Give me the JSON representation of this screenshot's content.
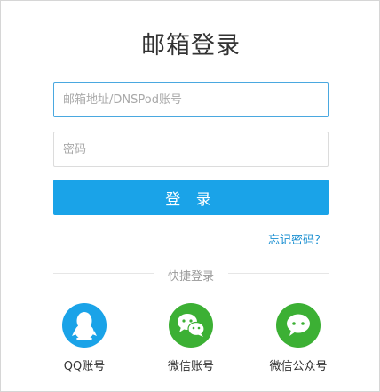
{
  "page": {
    "title": "邮箱登录"
  },
  "form": {
    "email_placeholder": "邮箱地址/DNSPod账号",
    "password_placeholder": "密码",
    "login_label": "登 录",
    "forgot_label": "忘记密码？"
  },
  "quick_login": {
    "label": "快捷登录",
    "options": [
      {
        "label": "QQ账号",
        "icon": "qq-penguin-icon",
        "color": "#1aa3e8"
      },
      {
        "label": "微信账号",
        "icon": "wechat-icon",
        "color": "#3cb034"
      },
      {
        "label": "微信公众号",
        "icon": "wechat-public-icon",
        "color": "#3cb034"
      }
    ]
  },
  "colors": {
    "accent": "#1aa3e8",
    "wechat": "#3cb034",
    "link": "#1a8fd1"
  }
}
